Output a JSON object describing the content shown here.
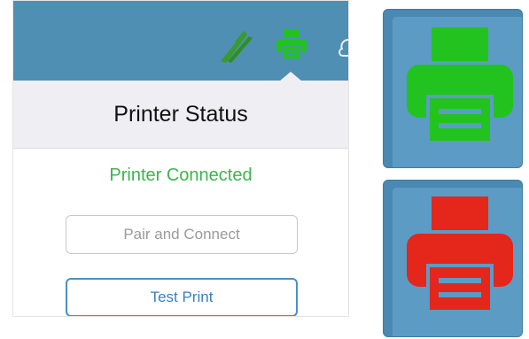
{
  "popover": {
    "title": "Printer Status",
    "status": "Printer Connected",
    "pair_button": "Pair and Connect",
    "test_button": "Test Print"
  },
  "toolbar": {
    "icons": [
      "cutlery-icon",
      "printer-icon",
      "cloud-icon"
    ]
  },
  "tiles": [
    {
      "name": "printer-connected-icon",
      "color": "#22c31f"
    },
    {
      "name": "printer-disconnected-icon",
      "color": "#e4261b"
    }
  ],
  "colors": {
    "toolbar": "#4f8fb4",
    "connected_green": "#3cb54a",
    "printer_green": "#22c31f",
    "printer_red": "#e4261b",
    "button_blue": "#3a7fbf",
    "tile_blue": "#4a89b3"
  }
}
